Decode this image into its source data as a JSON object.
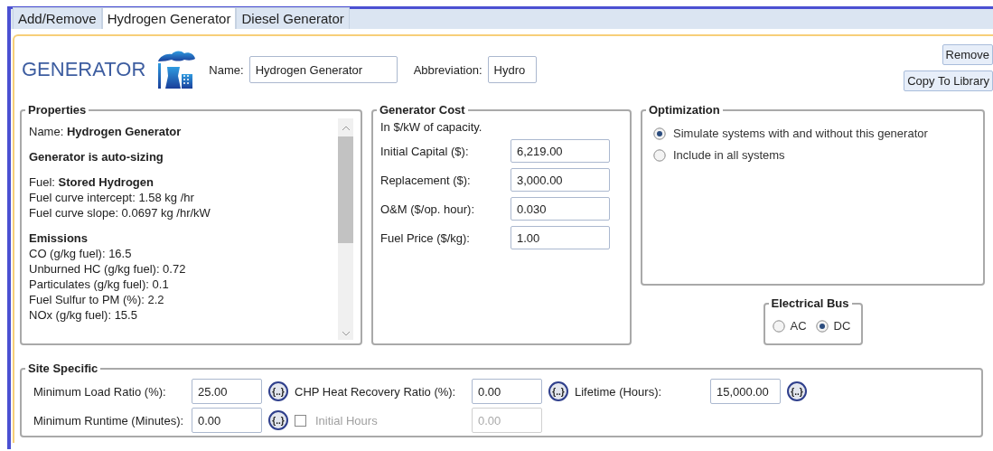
{
  "tabs": [
    {
      "label": "Add/Remove",
      "selected": false
    },
    {
      "label": "Hydrogen Generator",
      "selected": true
    },
    {
      "label": "Diesel Generator",
      "selected": false
    }
  ],
  "header": {
    "title": "GENERATOR",
    "name_label": "Name:",
    "name_value": "Hydrogen Generator",
    "abbreviation_label": "Abbreviation:",
    "abbreviation_value": "Hydro"
  },
  "buttons": [
    "Remove",
    "Copy To Library"
  ],
  "properties": {
    "title": "Properties",
    "sections": [
      [
        {
          "kind": "text",
          "text": "Name: **Hydrogen Generator**"
        }
      ],
      [
        {
          "kind": "heading",
          "text": "Generator is auto-sizing"
        }
      ],
      [
        {
          "kind": "text",
          "text": "Fuel:  **Stored Hydrogen**"
        },
        {
          "kind": "text",
          "text": "Fuel curve intercept:  1.58 kg /hr"
        },
        {
          "kind": "text",
          "text": "Fuel curve slope:  0.0697 kg /hr/kW"
        }
      ],
      [
        {
          "kind": "heading",
          "text": "Emissions"
        },
        {
          "kind": "text",
          "text": "CO (g/kg fuel): 16.5"
        },
        {
          "kind": "text",
          "text": "Unburned HC (g/kg fuel): 0.72"
        },
        {
          "kind": "text",
          "text": "Particulates (g/kg fuel): 0.1"
        },
        {
          "kind": "text",
          "text": "Fuel Sulfur to PM (%):  2.2"
        },
        {
          "kind": "text",
          "text": "NOx (g/kg fuel): 15.5"
        }
      ]
    ]
  },
  "generator_cost": {
    "title": "Generator Cost",
    "note": "In $/kW of capacity.",
    "fields": [
      {
        "label": "Initial Capital ($):",
        "value": "6,219.00"
      },
      {
        "label": "Replacement ($):",
        "value": "3,000.00"
      },
      {
        "label": "O&M ($/op. hour):",
        "value": "0.030"
      },
      {
        "label": "Fuel Price ($/kg):",
        "value": "1.00"
      }
    ]
  },
  "optimization": {
    "title": "Optimization",
    "options": [
      {
        "label": "Simulate systems with and without this generator",
        "selected": true
      },
      {
        "label": "Include in all systems",
        "selected": false
      }
    ]
  },
  "electrical_bus": {
    "title": "Electrical Bus",
    "options": [
      {
        "label": "AC",
        "selected": false
      },
      {
        "label": "DC",
        "selected": true
      }
    ]
  },
  "site_specific": {
    "title": "Site Specific",
    "items": [
      {
        "kind": "input",
        "label": "Minimum Load Ratio (%):",
        "value": "25.00",
        "button": "{..}"
      },
      {
        "kind": "input",
        "label": "CHP Heat Recovery Ratio (%):",
        "value": "0.00",
        "button": "{..}"
      },
      {
        "kind": "input",
        "label": "Lifetime (Hours):",
        "value": "15,000.00",
        "button": "{..}"
      },
      {
        "kind": "input",
        "label": "Minimum Runtime (Minutes):",
        "value": "0.00",
        "button": "{..}"
      },
      {
        "kind": "checkbox",
        "label": "Initial Hours",
        "checked": false,
        "disabled": true,
        "value": "0.00"
      }
    ]
  }
}
